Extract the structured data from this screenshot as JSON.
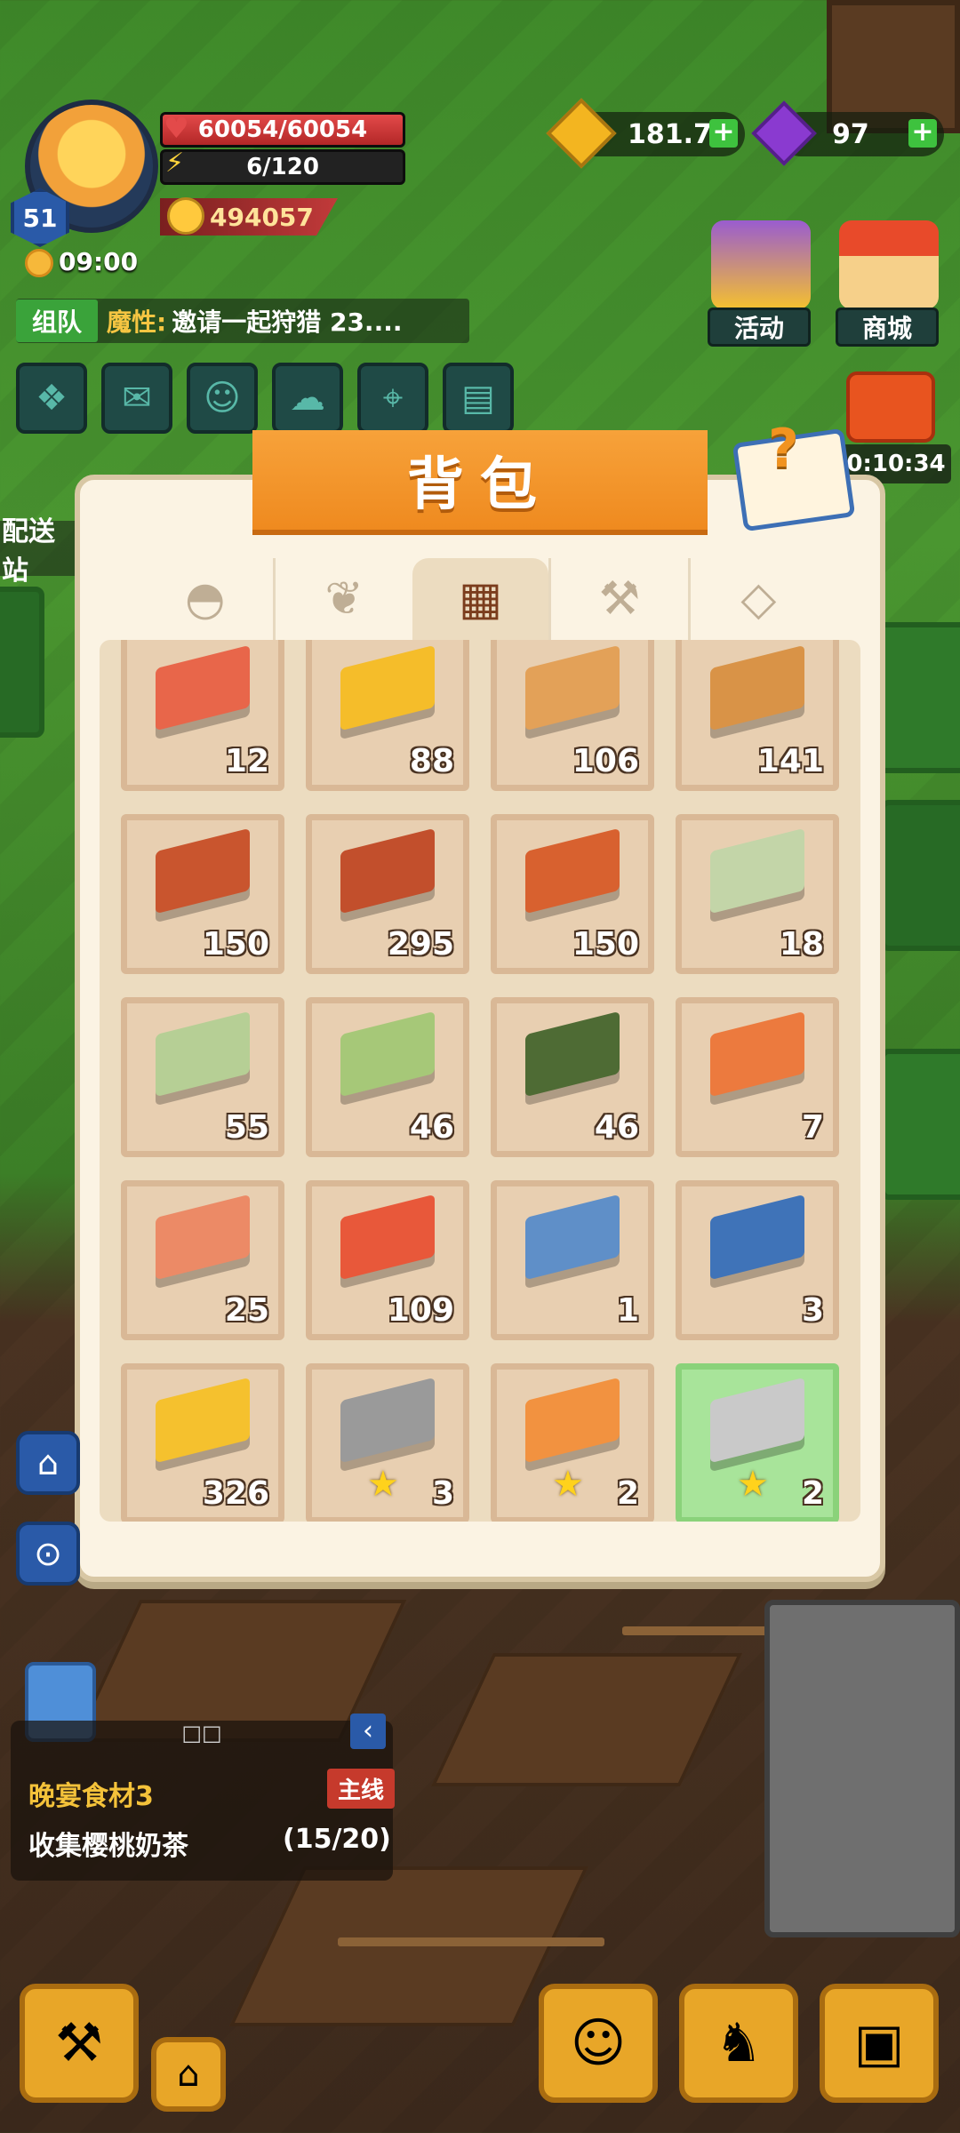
{
  "hud": {
    "level": "51",
    "hp": "60054/60054",
    "energy": "6/120",
    "power": "494057",
    "time": "09:00",
    "team": {
      "tag": "组队",
      "name": "魔性:",
      "message": "邀请一起狩猎 23...."
    }
  },
  "currency": {
    "gold": "181.7K",
    "gems": "97",
    "plus": "+"
  },
  "right_menu": {
    "event_label": "活动",
    "shop_label": "商城",
    "gift_timer": "0:10:34"
  },
  "side_station_label": "配送站",
  "backpack": {
    "title": "背包",
    "help_mark": "?",
    "tabs": [
      {
        "name": "bowl-icon",
        "glyph": "◓"
      },
      {
        "name": "wheat-icon",
        "glyph": "❦"
      },
      {
        "name": "bricks-icon",
        "glyph": "▦"
      },
      {
        "name": "tools-icon",
        "glyph": "⚒"
      },
      {
        "name": "diamond-icon",
        "glyph": "◇"
      }
    ],
    "items": [
      {
        "name": "copper-ingot",
        "count": "12",
        "color": "#e8664a"
      },
      {
        "name": "gold-ingot",
        "count": "88",
        "color": "#f5bd2a"
      },
      {
        "name": "wood-plank",
        "count": "106",
        "color": "#e3a158"
      },
      {
        "name": "wood-planks-stack",
        "count": "141",
        "color": "#d99347"
      },
      {
        "name": "red-wood-beam",
        "count": "150",
        "color": "#c9552e"
      },
      {
        "name": "double-red-beam",
        "count": "295",
        "color": "#c24f2c"
      },
      {
        "name": "framed-board",
        "count": "150",
        "color": "#d8612f"
      },
      {
        "name": "green-stone-block",
        "count": "18",
        "color": "#c3d5a8"
      },
      {
        "name": "green-stone-stack",
        "count": "55",
        "color": "#b6cf95"
      },
      {
        "name": "green-stone-slab",
        "count": "46",
        "color": "#a6c878"
      },
      {
        "name": "dark-green-slab",
        "count": "46",
        "color": "#4e6b34"
      },
      {
        "name": "blue-brick-stack",
        "count": "7",
        "color": "#ec7a3e"
      },
      {
        "name": "copper-plate",
        "count": "25",
        "color": "#ec8a66"
      },
      {
        "name": "copper-pipe",
        "count": "109",
        "color": "#e8583a"
      },
      {
        "name": "blue-plate",
        "count": "1",
        "color": "#5f8fc8"
      },
      {
        "name": "blue-pipe",
        "count": "3",
        "color": "#3f73b8"
      },
      {
        "name": "gold-plate",
        "count": "326",
        "color": "#f5c12e"
      },
      {
        "name": "gray-fish",
        "count": "3",
        "color": "#9a9a9a",
        "star": "★"
      },
      {
        "name": "clownfish",
        "count": "2",
        "color": "#f29240",
        "star": "★"
      },
      {
        "name": "silver-fish",
        "count": "2",
        "color": "#c9c9c9",
        "star": "★"
      }
    ]
  },
  "quest": {
    "header": "□□",
    "title": "晚宴食材3",
    "tag": "主线",
    "desc": "收集樱桃奶茶",
    "progress": "(15/20)"
  }
}
